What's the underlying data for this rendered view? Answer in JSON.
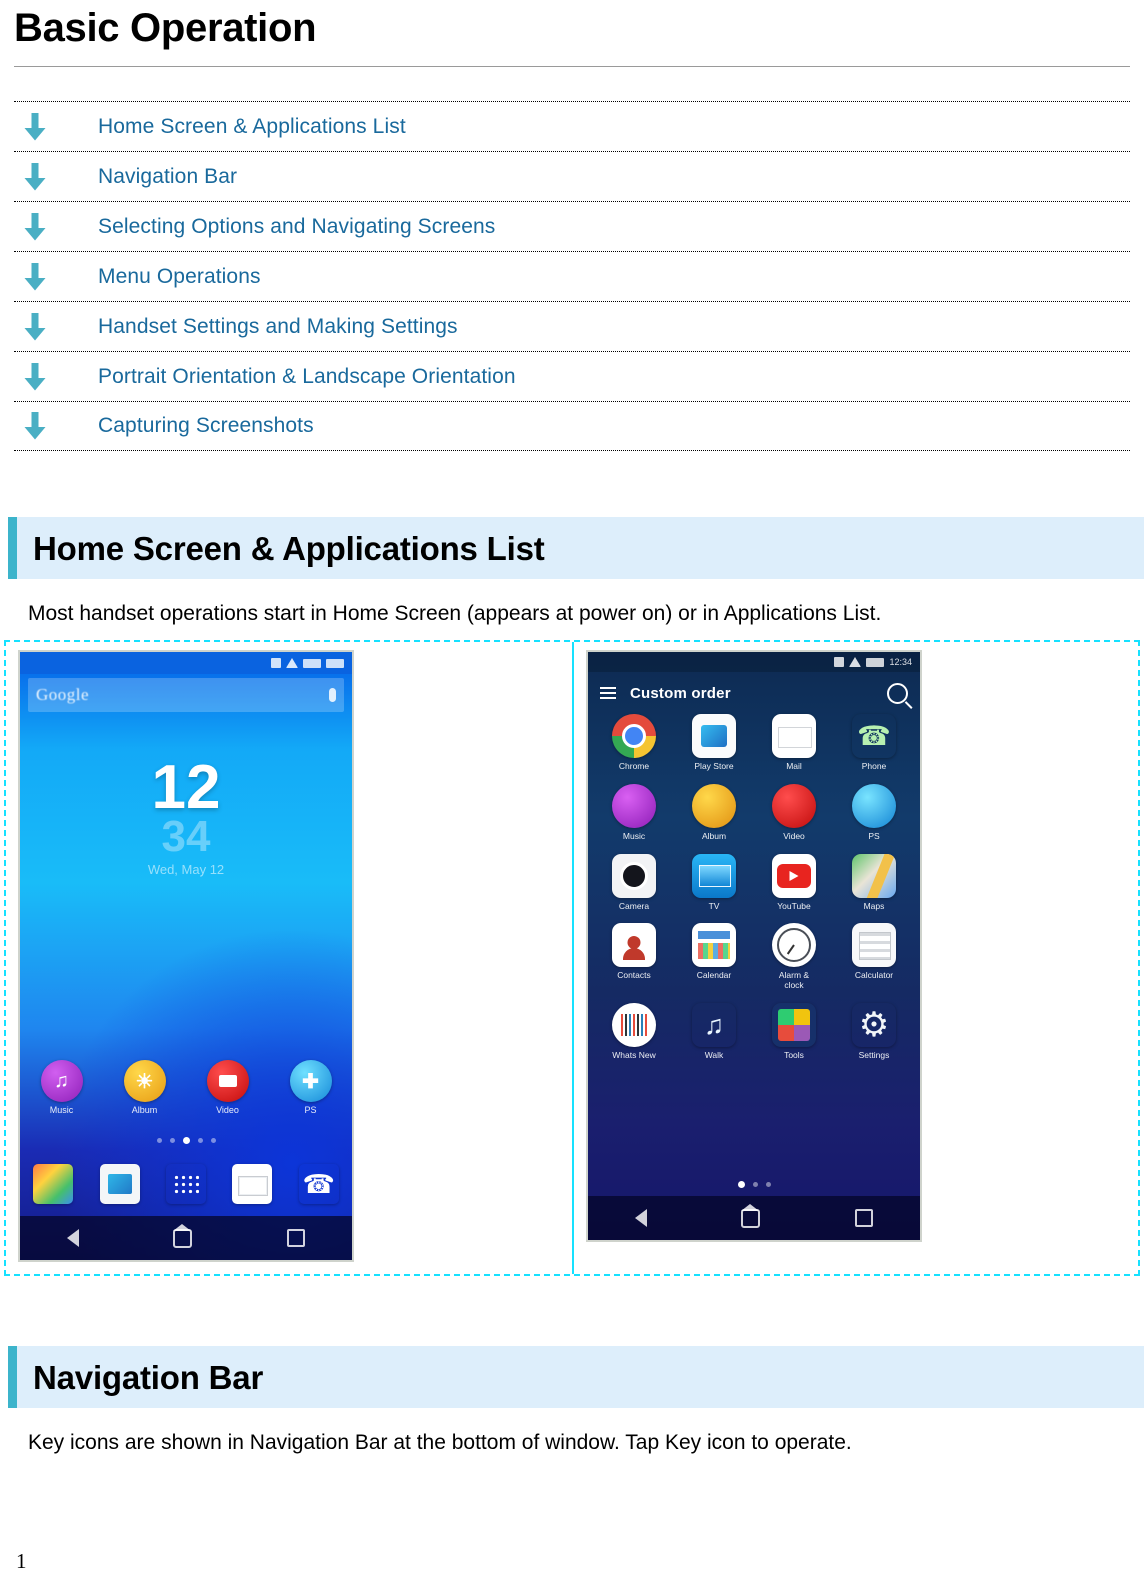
{
  "document": {
    "title": "Basic Operation",
    "page_number": "1"
  },
  "toc": {
    "items": [
      {
        "label": "Home Screen & Applications List",
        "icon": "down-arrow-icon"
      },
      {
        "label": "Navigation Bar",
        "icon": "down-arrow-icon"
      },
      {
        "label": "Selecting Options and Navigating Screens",
        "icon": "down-arrow-icon"
      },
      {
        "label": "Menu Operations",
        "icon": "down-arrow-icon"
      },
      {
        "label": "Handset Settings and Making Settings",
        "icon": "down-arrow-icon"
      },
      {
        "label": "Portrait Orientation & Landscape Orientation",
        "icon": "down-arrow-icon"
      },
      {
        "label": "Capturing Screenshots",
        "icon": "down-arrow-icon"
      }
    ]
  },
  "sections": [
    {
      "heading": "Home Screen & Applications List",
      "body": "Most handset operations start in Home Screen (appears at power on) or in Applications List."
    },
    {
      "heading": "Navigation Bar",
      "body": "Key icons are shown in Navigation Bar at the bottom of window. Tap Key icon to operate."
    }
  ],
  "figures": {
    "home_screen": {
      "search_placeholder": "Google",
      "clock_hour": "12",
      "clock_minute": "34",
      "clock_date": "Wed, May 12",
      "apps": [
        {
          "label": "Music",
          "icon": "music-icon"
        },
        {
          "label": "Album",
          "icon": "album-icon"
        },
        {
          "label": "Video",
          "icon": "video-icon"
        },
        {
          "label": "PS",
          "icon": "ps-icon"
        }
      ],
      "dock": [
        {
          "label": "Gallery",
          "icon": "gallery-icon"
        },
        {
          "label": "Play Store",
          "icon": "play-store-icon"
        },
        {
          "label": "Apps",
          "icon": "apps-grid-icon"
        },
        {
          "label": "Mail",
          "icon": "mail-icon"
        },
        {
          "label": "Phone",
          "icon": "phone-icon"
        }
      ]
    },
    "applications_list": {
      "header_title": "Custom order",
      "status_time": "12:34",
      "apps": [
        {
          "label": "Chrome",
          "icon": "chrome-icon"
        },
        {
          "label": "Play Store",
          "icon": "play-store-icon"
        },
        {
          "label": "Mail",
          "icon": "mail-icon"
        },
        {
          "label": "Phone",
          "icon": "phone-icon"
        },
        {
          "label": "Music",
          "icon": "music-icon"
        },
        {
          "label": "Album",
          "icon": "album-icon"
        },
        {
          "label": "Video",
          "icon": "video-icon"
        },
        {
          "label": "PS",
          "icon": "ps-icon"
        },
        {
          "label": "Camera",
          "icon": "camera-icon"
        },
        {
          "label": "TV",
          "icon": "tv-icon"
        },
        {
          "label": "YouTube",
          "icon": "youtube-icon"
        },
        {
          "label": "Maps",
          "icon": "maps-icon"
        },
        {
          "label": "Contacts",
          "icon": "contacts-icon"
        },
        {
          "label": "Calendar",
          "icon": "calendar-icon"
        },
        {
          "label": "Alarm &\nclock",
          "icon": "alarm-clock-icon"
        },
        {
          "label": "Calculator",
          "icon": "calculator-icon"
        },
        {
          "label": "Whats New",
          "icon": "barcode-icon"
        },
        {
          "label": "Walk",
          "icon": "music-note-icon"
        },
        {
          "label": "Tools",
          "icon": "folder-icon"
        },
        {
          "label": "Settings",
          "icon": "settings-gear-icon"
        }
      ]
    }
  },
  "colors": {
    "accent_teal": "#3cb4cb",
    "heading_bg": "#ddeefb",
    "link_blue": "#19699c",
    "table_border_cyan": "#16e1ff"
  }
}
